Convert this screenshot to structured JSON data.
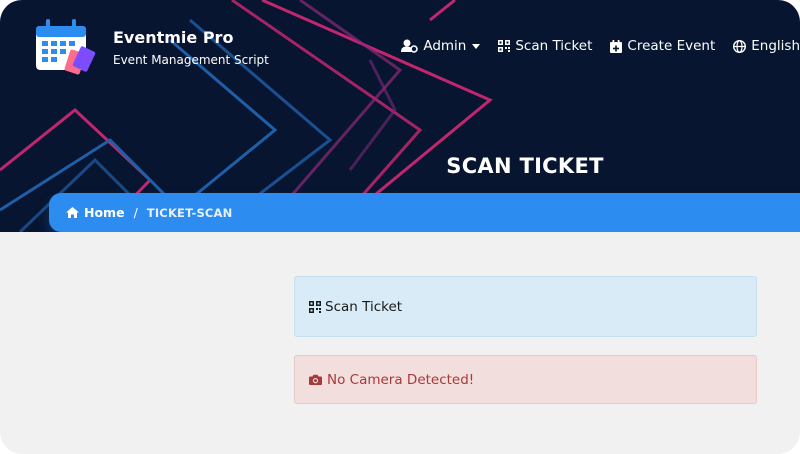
{
  "brand": {
    "name": "Eventmie Pro",
    "tagline": "Event Management Script"
  },
  "nav": {
    "admin": "Admin",
    "scan_ticket": "Scan Ticket",
    "create_event": "Create Event",
    "language": "English"
  },
  "page": {
    "title": "SCAN TICKET"
  },
  "breadcrumb": {
    "home": "Home",
    "separator": "/",
    "current": "TICKET-SCAN"
  },
  "scan_card": {
    "label": "Scan Ticket"
  },
  "camera_alert": {
    "message": "No Camera Detected!"
  },
  "colors": {
    "header_bg": "#071530",
    "accent_blue": "#2d8cef",
    "stripe_pink": "#c2266f",
    "stripe_blue": "#1f5fa8",
    "info_bg": "#d8ebf7",
    "alert_bg": "#f3dede",
    "alert_text": "#a63a3a"
  },
  "icons": {
    "admin": "user-cog-icon",
    "scan": "qrcode-icon",
    "create": "calendar-plus-icon",
    "language": "globe-icon",
    "home": "home-icon",
    "camera": "camera-icon"
  }
}
